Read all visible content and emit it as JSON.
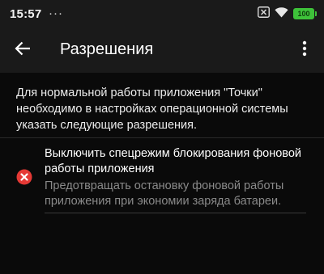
{
  "status_bar": {
    "time": "15:57",
    "more_indicator": "···",
    "icons": [
      "sim-off-icon",
      "wifi-icon",
      "battery-icon"
    ],
    "battery_level": "100"
  },
  "toolbar": {
    "back_icon": "arrow-back-icon",
    "title": "Разрешения",
    "overflow_icon": "more-vert-icon"
  },
  "intro_text": "Для нормальной работы приложения \"Точки\" необходимо в настройках операционной системы указать следующие разрешения.",
  "permissions": [
    {
      "status_icon": "error-icon",
      "title": "Выключить спецрежим блокирования фоновой работы приложения",
      "description": "Предотвращать остановку фоновой работы приложения при экономии заряда батареи."
    }
  ],
  "colors": {
    "background": "#0a0a0a",
    "bar_background": "#1a1a1a",
    "error_red": "#e53935",
    "battery_green": "#3ec23a",
    "secondary_text": "#8a8a8a"
  }
}
